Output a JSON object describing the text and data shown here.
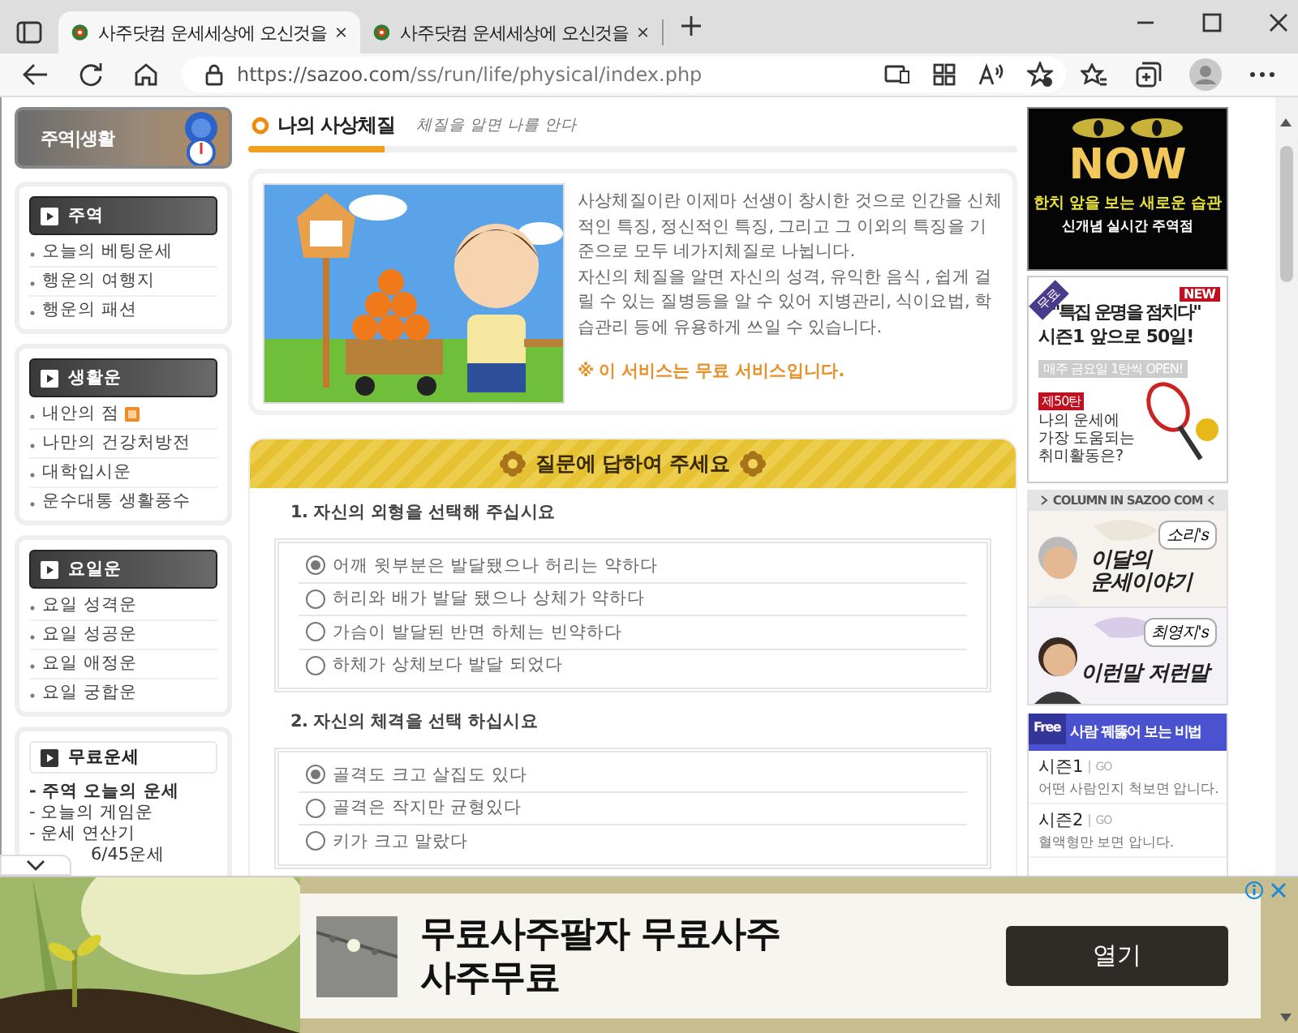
{
  "browser": {
    "tabs": [
      {
        "title": "사주닷컴 운세세상에 오신것을",
        "selected": true
      },
      {
        "title": "사주닷컴 운세세상에 오신것을",
        "selected": false
      }
    ],
    "address": {
      "host": "https://sazoo.com",
      "path": "/ss/run/life/physical/index.php"
    }
  },
  "sidebar": {
    "title": "주역|생활",
    "sections": [
      {
        "title": "주역",
        "items": [
          {
            "label": "오늘의 베팅운세",
            "new": false
          },
          {
            "label": "행운의 여행지",
            "new": false
          },
          {
            "label": "행운의 패션",
            "new": false
          }
        ]
      },
      {
        "title": "생활운",
        "items": [
          {
            "label": "내안의 점",
            "new": true
          },
          {
            "label": "나만의 건강처방전",
            "new": false
          },
          {
            "label": "대학입시운",
            "new": false
          },
          {
            "label": "운수대통 생활풍수",
            "new": false
          }
        ]
      },
      {
        "title": "요일운",
        "items": [
          {
            "label": "요일 성격운",
            "new": false
          },
          {
            "label": "요일 성공운",
            "new": false
          },
          {
            "label": "요일 애정운",
            "new": false
          },
          {
            "label": "요일 궁합운",
            "new": false
          }
        ]
      }
    ],
    "free": {
      "title": "무료운세",
      "items": [
        {
          "label": "- 주역 오늘의 운세",
          "bold": true
        },
        {
          "label": "- 오늘의 게임운",
          "bold": false
        },
        {
          "label": "- 운세 연산기",
          "bold": false
        },
        {
          "label": "6/45운세",
          "bold": false
        }
      ]
    }
  },
  "content": {
    "title": "나의 사상체질",
    "subtitle": "체질을 알면 나를 안다",
    "intro": [
      "사상체질이란 이제마 선생이 창시한 것으로 인간을 신체적인 특징, 정신적인 특징, 그리고 그 이외의 특징을 기준으로 모두 네가지체질로 나뉩니다.",
      "자신의 체질을 알면 자신의 성격, 유익한 음식 , 쉽게 걸릴 수 있는 질병등을 알 수 있어 지병관리, 식이요법, 학습관리 등에 유용하게 쓰일 수 있습니다."
    ],
    "notice": "※ 이 서비스는 무료 서비스입니다.",
    "questions_header": "질문에 답하여 주세요",
    "questions": [
      {
        "title": "1. 자신의 외형을 선택해 주십시요",
        "options": [
          {
            "label": "어깨 윗부분은 발달됐으나 허리는 약하다",
            "selected": true
          },
          {
            "label": "허리와 배가 발달 됐으나 상체가 약하다",
            "selected": false
          },
          {
            "label": "가슴이 발달된 반면 하체는 빈약하다",
            "selected": false
          },
          {
            "label": "하체가 상체보다 발달 되었다",
            "selected": false
          }
        ]
      },
      {
        "title": "2. 자신의 체격을 선택 하십시요",
        "options": [
          {
            "label": "골격도 크고 살집도 있다",
            "selected": true
          },
          {
            "label": "골격은 작지만 균형있다",
            "selected": false
          },
          {
            "label": "키가 크고 말랐다",
            "selected": false
          }
        ]
      }
    ]
  },
  "right_column": {
    "now_banner": {
      "headline": "NOW",
      "line_1": "한치 앞을 보는 새로운 습관",
      "line_2": "신개념 실시간 주역점"
    },
    "special_banner": {
      "ribbon": "무료",
      "badge": "NEW",
      "title": "\"특집 운명을 점치다\"",
      "subtitle": "시즌1 앞으로 50일!",
      "schedule": "매주 금요일 1탄씩 OPEN!",
      "episode": "제50탄",
      "question": "나의 운세에 가장 도움되는 취미활동은?"
    },
    "column_header": "COLUMN IN SAZOO COM",
    "columns": [
      {
        "author": "소리's",
        "title": "이달의 운세이야기"
      },
      {
        "author": "최영지's",
        "title": "이런말 저런말"
      }
    ],
    "secret_box": {
      "badge": "Free",
      "title": "사람 꿰뚫어 보는 비법",
      "items": [
        {
          "season": "시즌1",
          "link": "GO",
          "desc": "어떤 사람인지 척보면 압니다."
        },
        {
          "season": "시즌2",
          "link": "GO",
          "desc": "혈액형만 보면 압니다."
        }
      ]
    }
  },
  "ad": {
    "title": "무료사주팔자 무료사주 사주무료",
    "button": "열기"
  }
}
